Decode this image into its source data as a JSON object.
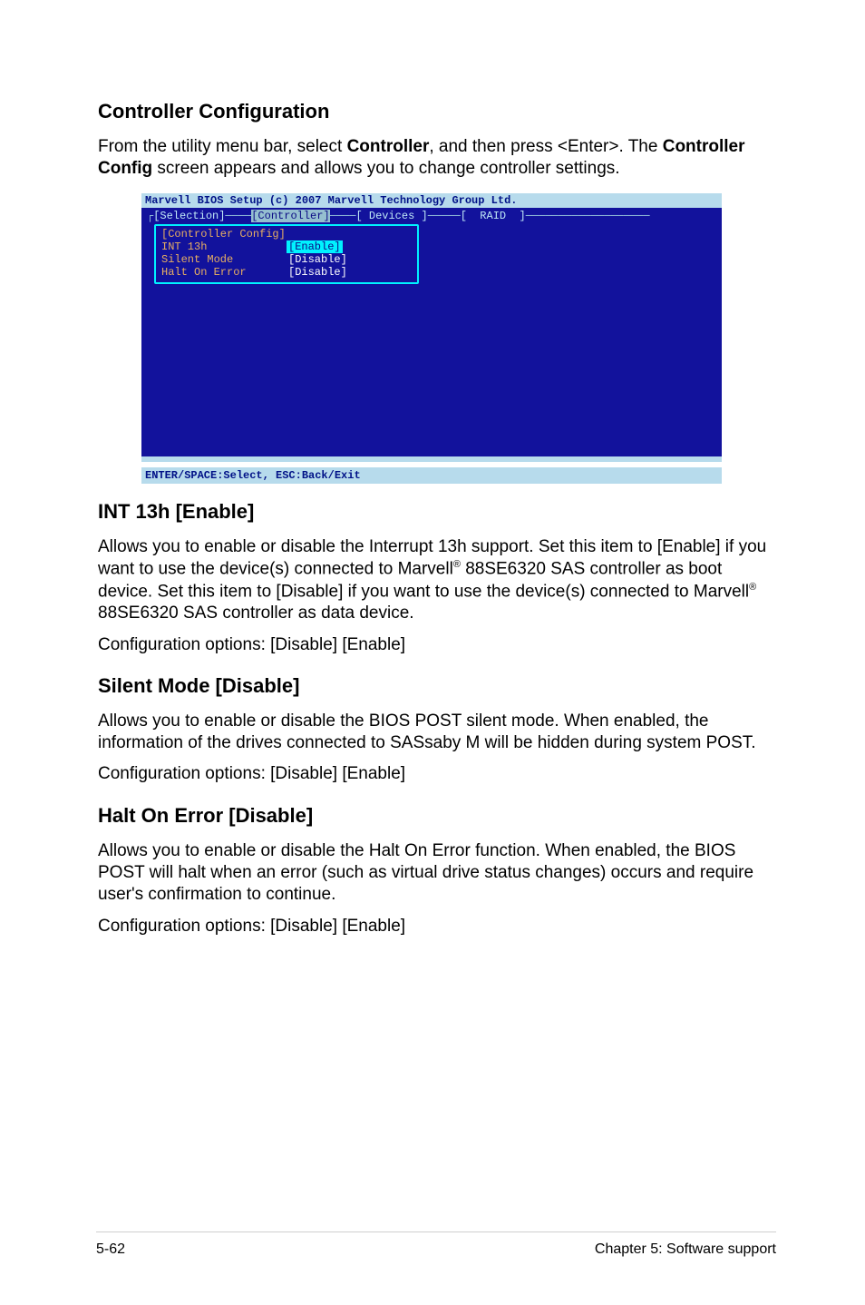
{
  "sections": {
    "controller_config": {
      "heading": "Controller Configuration",
      "intro_pre": "From the utility menu bar, select ",
      "intro_bold1": "Controller",
      "intro_mid": ", and then press <Enter>. The ",
      "intro_bold2": "Controller Config",
      "intro_post": " screen appears and allows you to change controller settings."
    },
    "int13h": {
      "heading": "INT 13h [Enable]",
      "p1a": "Allows you to enable or disable the Interrupt 13h support. Set this item to [Enable] if you want to use the device(s) connected to Marvell",
      "p1b": " 88SE6320 SAS controller as boot device. Set this item to [Disable] if you want to use the device(s) connected to Marvell",
      "p1c": " 88SE6320 SAS controller as data device.",
      "reg": "®",
      "opts": "Configuration options: [Disable] [Enable]"
    },
    "silent": {
      "heading": "Silent Mode [Disable]",
      "p1": "Allows you to enable or disable the BIOS POST silent mode. When enabled, the information of the drives connected to SASsaby M will be hidden during system POST.",
      "opts": "Configuration options: [Disable] [Enable]"
    },
    "halt": {
      "heading": "Halt On Error [Disable]",
      "p1": "Allows you to enable or disable the Halt On Error function. When enabled, the BIOS POST will halt when an error (such as virtual drive status changes) occurs and require user's confirmation to continue.",
      "opts": "Configuration options: [Disable] [Enable]"
    }
  },
  "bios": {
    "title": "Marvell BIOS Setup (c) 2007 Marvell Technology Group Ltd.",
    "tabs": {
      "selection": "[Selection]",
      "controller": "[Controller]",
      "devices": "[ Devices ]",
      "raid": "[  RAID  ]"
    },
    "config_title": "[Controller Config]",
    "rows": [
      {
        "label": "INT 13h",
        "value": "[Enable]",
        "hl": true
      },
      {
        "label": "Silent Mode",
        "value": "[Disable]",
        "hl": false
      },
      {
        "label": "Halt On Error",
        "value": "[Disable]",
        "hl": false
      }
    ],
    "footer": "ENTER/SPACE:Select, ESC:Back/Exit"
  },
  "page_footer": {
    "left": "5-62",
    "right": "Chapter 5: Software support"
  }
}
